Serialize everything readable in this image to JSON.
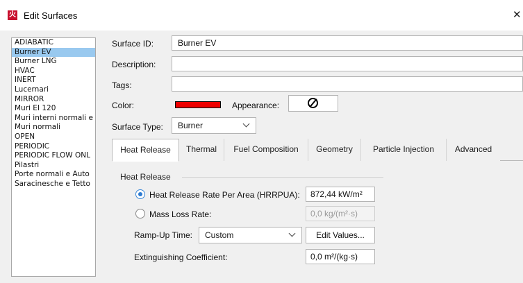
{
  "window": {
    "title": "Edit Surfaces",
    "app_icon_glyph": "火",
    "close_glyph": "✕"
  },
  "surfaces": {
    "items": [
      "ADIABATIC",
      "Burner EV",
      "Burner LNG",
      "HVAC",
      "INERT",
      "Lucernari",
      "MIRROR",
      "Muri EI 120",
      "Muri interni normali e I",
      "Muri normali",
      "OPEN",
      "PERIODIC",
      "PERIODIC FLOW ONL",
      "Pilastri",
      "Porte normali e Auto",
      "Saracinesche e Tetto"
    ],
    "selected": "Burner EV"
  },
  "form": {
    "surface_id_label": "Surface ID:",
    "surface_id_value": "Burner EV",
    "description_label": "Description:",
    "description_value": "",
    "tags_label": "Tags:",
    "tags_value": "",
    "color_label": "Color:",
    "color_value": "#ee0000",
    "appearance_label": "Appearance:",
    "appearance_icon": "no-symbol-icon",
    "surface_type_label": "Surface Type:",
    "surface_type_value": "Burner"
  },
  "tabs": [
    {
      "label": "Heat Release",
      "active": true
    },
    {
      "label": "Thermal",
      "active": false
    },
    {
      "label": "Fuel Composition",
      "active": false
    },
    {
      "label": "Geometry",
      "active": false
    },
    {
      "label": "Particle Injection",
      "active": false
    },
    {
      "label": "Advanced",
      "active": false
    }
  ],
  "heat_release": {
    "group_title": "Heat Release",
    "hrrpua_label": "Heat Release Rate Per Area (HRRPUA):",
    "hrrpua_value": "872,44 kW/m²",
    "hrrpua_selected": true,
    "mass_loss_label": "Mass Loss Rate:",
    "mass_loss_value": "0,0 kg/(m²·s)",
    "mass_loss_selected": false,
    "ramp_up_label": "Ramp-Up Time:",
    "ramp_up_value": "Custom",
    "edit_values_label": "Edit Values...",
    "extinguishing_label": "Extinguishing Coefficient:",
    "extinguishing_value": "0,0 m²/(kg·s)"
  },
  "colors": {
    "selection": "#99c9ef",
    "radio_accent": "#2d7bd1"
  }
}
